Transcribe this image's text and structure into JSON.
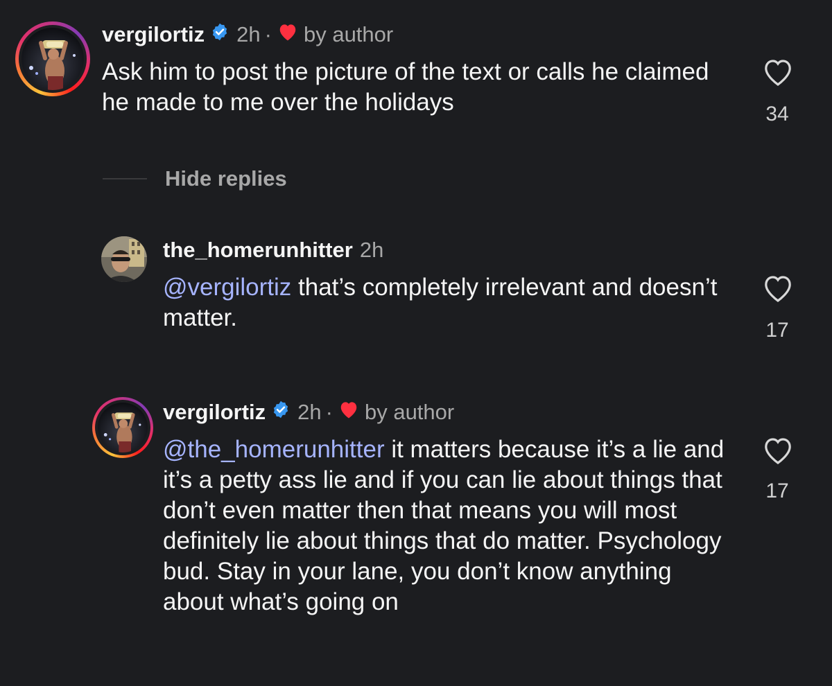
{
  "comments": [
    {
      "username": "vergilortiz",
      "verified": true,
      "time": "2h",
      "separator": "·",
      "liked_by_author": "by author",
      "text": "Ask him to post the picture of the text or calls he claimed he made to me over the holidays",
      "mention": "",
      "likes": "34"
    },
    {
      "username": "the_homerunhitter",
      "verified": false,
      "time": "2h",
      "mention": "@vergilortiz",
      "text": " that’s completely irrelevant and doesn’t matter.",
      "likes": "17"
    },
    {
      "username": "vergilortiz",
      "verified": true,
      "time": "2h",
      "separator": "·",
      "liked_by_author": "by author",
      "mention": "@the_homerunhitter",
      "text": " it matters because it’s a lie and it’s a petty ass lie and if you can lie about things that don’t even matter then that means you will most definitely lie about things that do matter. Psychology bud. Stay in your lane, you don’t know anything about what’s going on",
      "likes": "17"
    }
  ],
  "replies_toggle": {
    "label": "Hide replies"
  },
  "icons": {
    "verified": "verified-badge-icon",
    "heart_filled": "heart-filled-icon",
    "heart_outline": "heart-outline-icon"
  },
  "colors": {
    "background": "#1c1d20",
    "text": "#f5f5f5",
    "meta": "#a8a8a8",
    "mention": "#a6b4ff",
    "verified_blue": "#3897f0",
    "heart_red": "#ff3040"
  }
}
